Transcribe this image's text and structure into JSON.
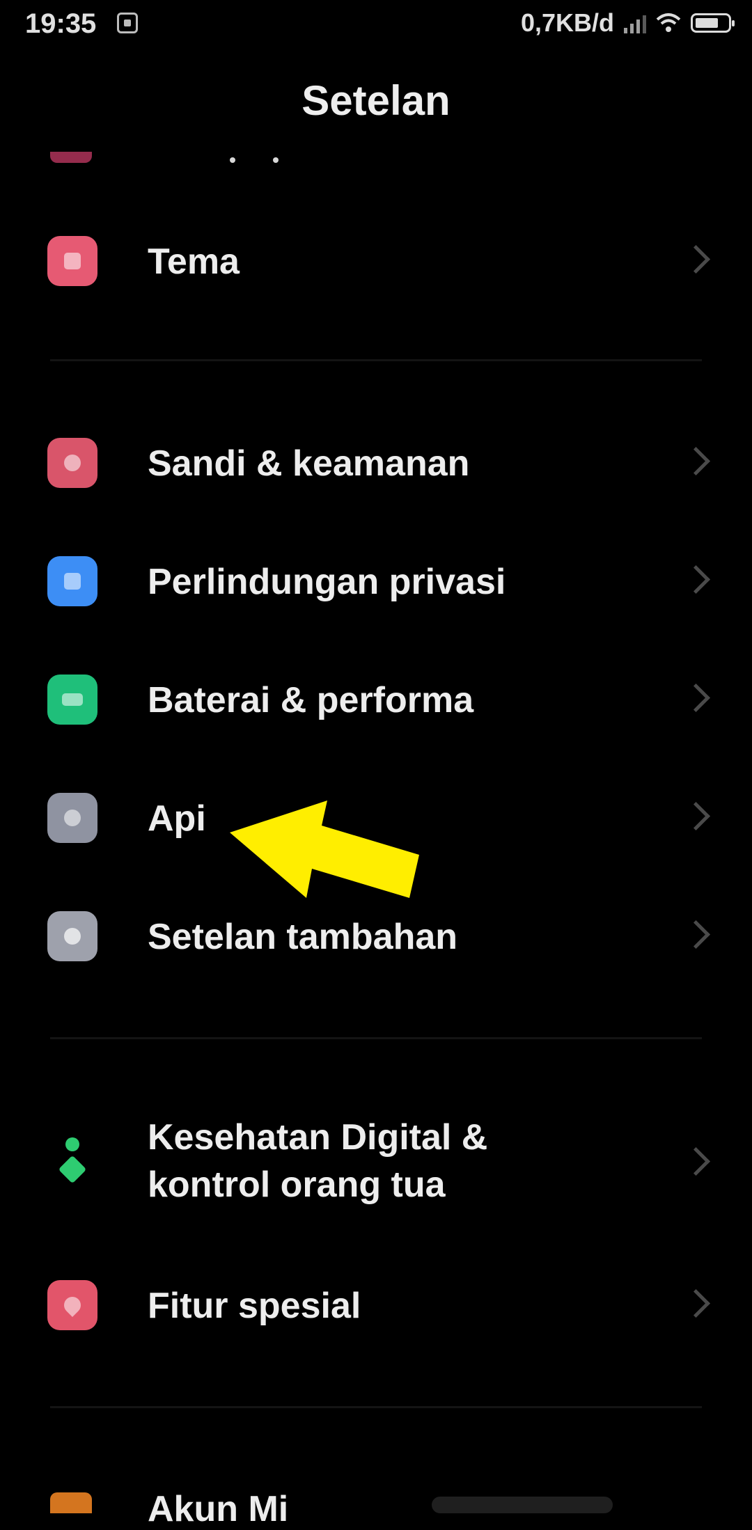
{
  "status": {
    "time": "19:35",
    "speed": "0,7KB/d"
  },
  "header": {
    "title": "Setelan"
  },
  "items": [
    {
      "label": "Tema",
      "color": "#e65a73"
    },
    {
      "label": "Sandi & keamanan",
      "color": "#d9556a"
    },
    {
      "label": "Perlindungan privasi",
      "color": "#3d8ef5"
    },
    {
      "label": "Baterai & performa",
      "color": "#1fbf7a"
    },
    {
      "label": "Api",
      "color": "#8f93a1"
    },
    {
      "label": "Setelan tambahan",
      "color": "#9ea1ac"
    },
    {
      "label": "Kesehatan Digital & kontrol orang tua",
      "color": "#2ecc71"
    },
    {
      "label": "Fitur spesial",
      "color": "#e2556a"
    }
  ],
  "bottom_item": {
    "label": "Akun Mi"
  },
  "annotation": {
    "arrow_color": "#ffee00",
    "icon": "arrow-pointer-icon"
  },
  "icons": {
    "tema": "theme-icon",
    "sandi": "lock-icon",
    "privasi": "privacy-shield-icon",
    "baterai": "battery-icon",
    "apl": "apps-icon",
    "tambahan": "more-settings-icon",
    "digital": "digital-wellbeing-icon",
    "fitur": "special-features-icon"
  }
}
